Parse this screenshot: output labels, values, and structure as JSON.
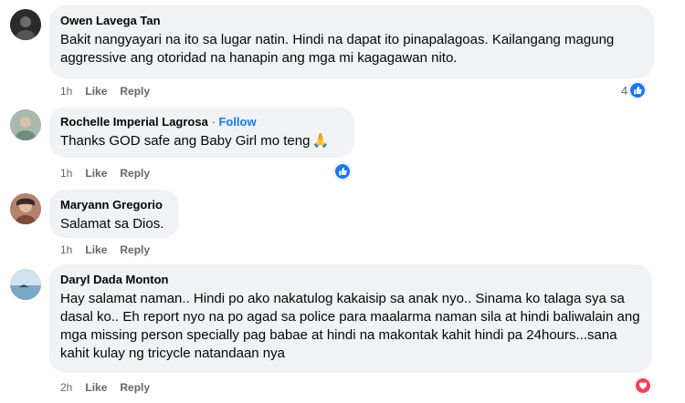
{
  "comments": [
    {
      "author": "Owen Lavega Tan",
      "follow": "",
      "text": "Bakit nangyayari na ito sa lugar natin. Hindi na dapat ito pinapalagoas. Kailangang magung aggressive ang otoridad na hanapin ang mga mi kagagawan nito.",
      "time": "1h",
      "like": "Like",
      "reply": "Reply",
      "reaction_count": "4",
      "reaction_type": "like",
      "avatar_color": "#3a3a3a"
    },
    {
      "author": "Rochelle Imperial Lagrosa",
      "separator": "·",
      "follow": "Follow",
      "text": "Thanks GOD safe ang Baby Girl mo teng",
      "emoji": "🙏",
      "time": "1h",
      "like": "Like",
      "reply": "Reply",
      "reaction_count": "",
      "reaction_type": "like",
      "avatar_color": "#8fa89a"
    },
    {
      "author": "Maryann Gregorio",
      "follow": "",
      "text": "Salamat sa Dios.",
      "time": "1h",
      "like": "Like",
      "reply": "Reply",
      "reaction_count": "",
      "reaction_type": "",
      "avatar_color": "#a06a5a"
    },
    {
      "author": "Daryl Dada Monton",
      "follow": "",
      "text": "Hay salamat naman.. Hindi po ako nakatulog kakaisip sa anak nyo.. Sinama ko talaga sya sa dasal ko.. Eh report nyo na po agad sa police para maalarma naman sila at hindi baliwalain ang mga missing person specially pag babae at hindi na makontak kahit hindi pa 24hours...sana kahit kulay ng tricycle natandaan nya",
      "time": "2h",
      "like": "Like",
      "reply": "Reply",
      "reaction_count": "",
      "reaction_type": "love",
      "avatar_color": "#9cc3da"
    }
  ]
}
